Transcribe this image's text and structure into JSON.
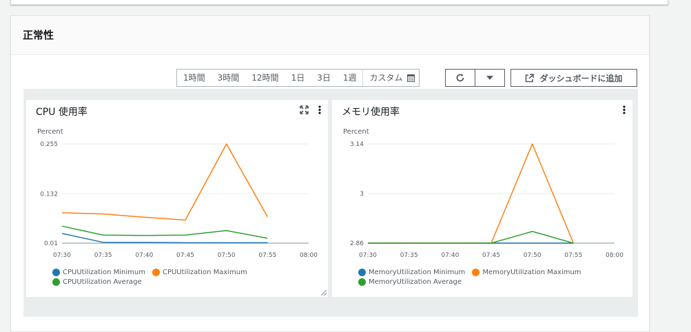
{
  "section": {
    "title": "正常性"
  },
  "time_range": {
    "options": [
      "1時間",
      "3時間",
      "12時間",
      "1日",
      "3日",
      "1週"
    ],
    "custom_label": "カスタム"
  },
  "toolbar": {
    "add_to_dashboard": "ダッシュボードに追加"
  },
  "colors": {
    "minimum": "#1f77b4",
    "maximum": "#ff7f0e",
    "average": "#2ca02c"
  },
  "widgets": {
    "cpu": {
      "title": "CPU 使用率",
      "unit": "Percent",
      "legend": [
        "CPUUtilization Minimum",
        "CPUUtilization Maximum",
        "CPUUtilization Average"
      ]
    },
    "memory": {
      "title": "メモリ使用率",
      "unit": "Percent",
      "legend": [
        "MemoryUtilization Minimum",
        "MemoryUtilization Maximum",
        "MemoryUtilization Average"
      ]
    }
  },
  "chart_data": [
    {
      "type": "line",
      "title": "CPU 使用率",
      "ylabel": "Percent",
      "x": [
        "07:30",
        "07:35",
        "07:40",
        "07:45",
        "07:50",
        "07:55",
        "08:00"
      ],
      "y_ticks": [
        "0.255",
        "0.132",
        "0.01"
      ],
      "ylim": [
        0.01,
        0.255
      ],
      "series": [
        {
          "name": "CPUUtilization Minimum",
          "values": [
            0.034,
            0.012,
            0.012,
            0.011,
            0.011,
            0.011,
            null
          ]
        },
        {
          "name": "CPUUtilization Maximum",
          "values": [
            0.085,
            0.082,
            0.074,
            0.067,
            0.255,
            0.075,
            null
          ]
        },
        {
          "name": "CPUUtilization Average",
          "values": [
            0.052,
            0.03,
            0.029,
            0.03,
            0.041,
            0.022,
            null
          ]
        }
      ]
    },
    {
      "type": "line",
      "title": "メモリ使用率",
      "ylabel": "Percent",
      "x": [
        "07:30",
        "07:35",
        "07:40",
        "07:45",
        "07:50",
        "07:55",
        "08:00"
      ],
      "y_ticks": [
        "3.14",
        "3",
        "2.86"
      ],
      "ylim": [
        2.86,
        3.14
      ],
      "series": [
        {
          "name": "MemoryUtilization Minimum",
          "values": [
            2.86,
            2.86,
            2.86,
            2.86,
            2.86,
            2.86,
            null
          ]
        },
        {
          "name": "MemoryUtilization Maximum",
          "values": [
            2.86,
            2.86,
            2.86,
            2.86,
            3.14,
            2.86,
            null
          ]
        },
        {
          "name": "MemoryUtilization Average",
          "values": [
            2.86,
            2.86,
            2.86,
            2.86,
            2.893,
            2.86,
            null
          ]
        }
      ]
    }
  ]
}
